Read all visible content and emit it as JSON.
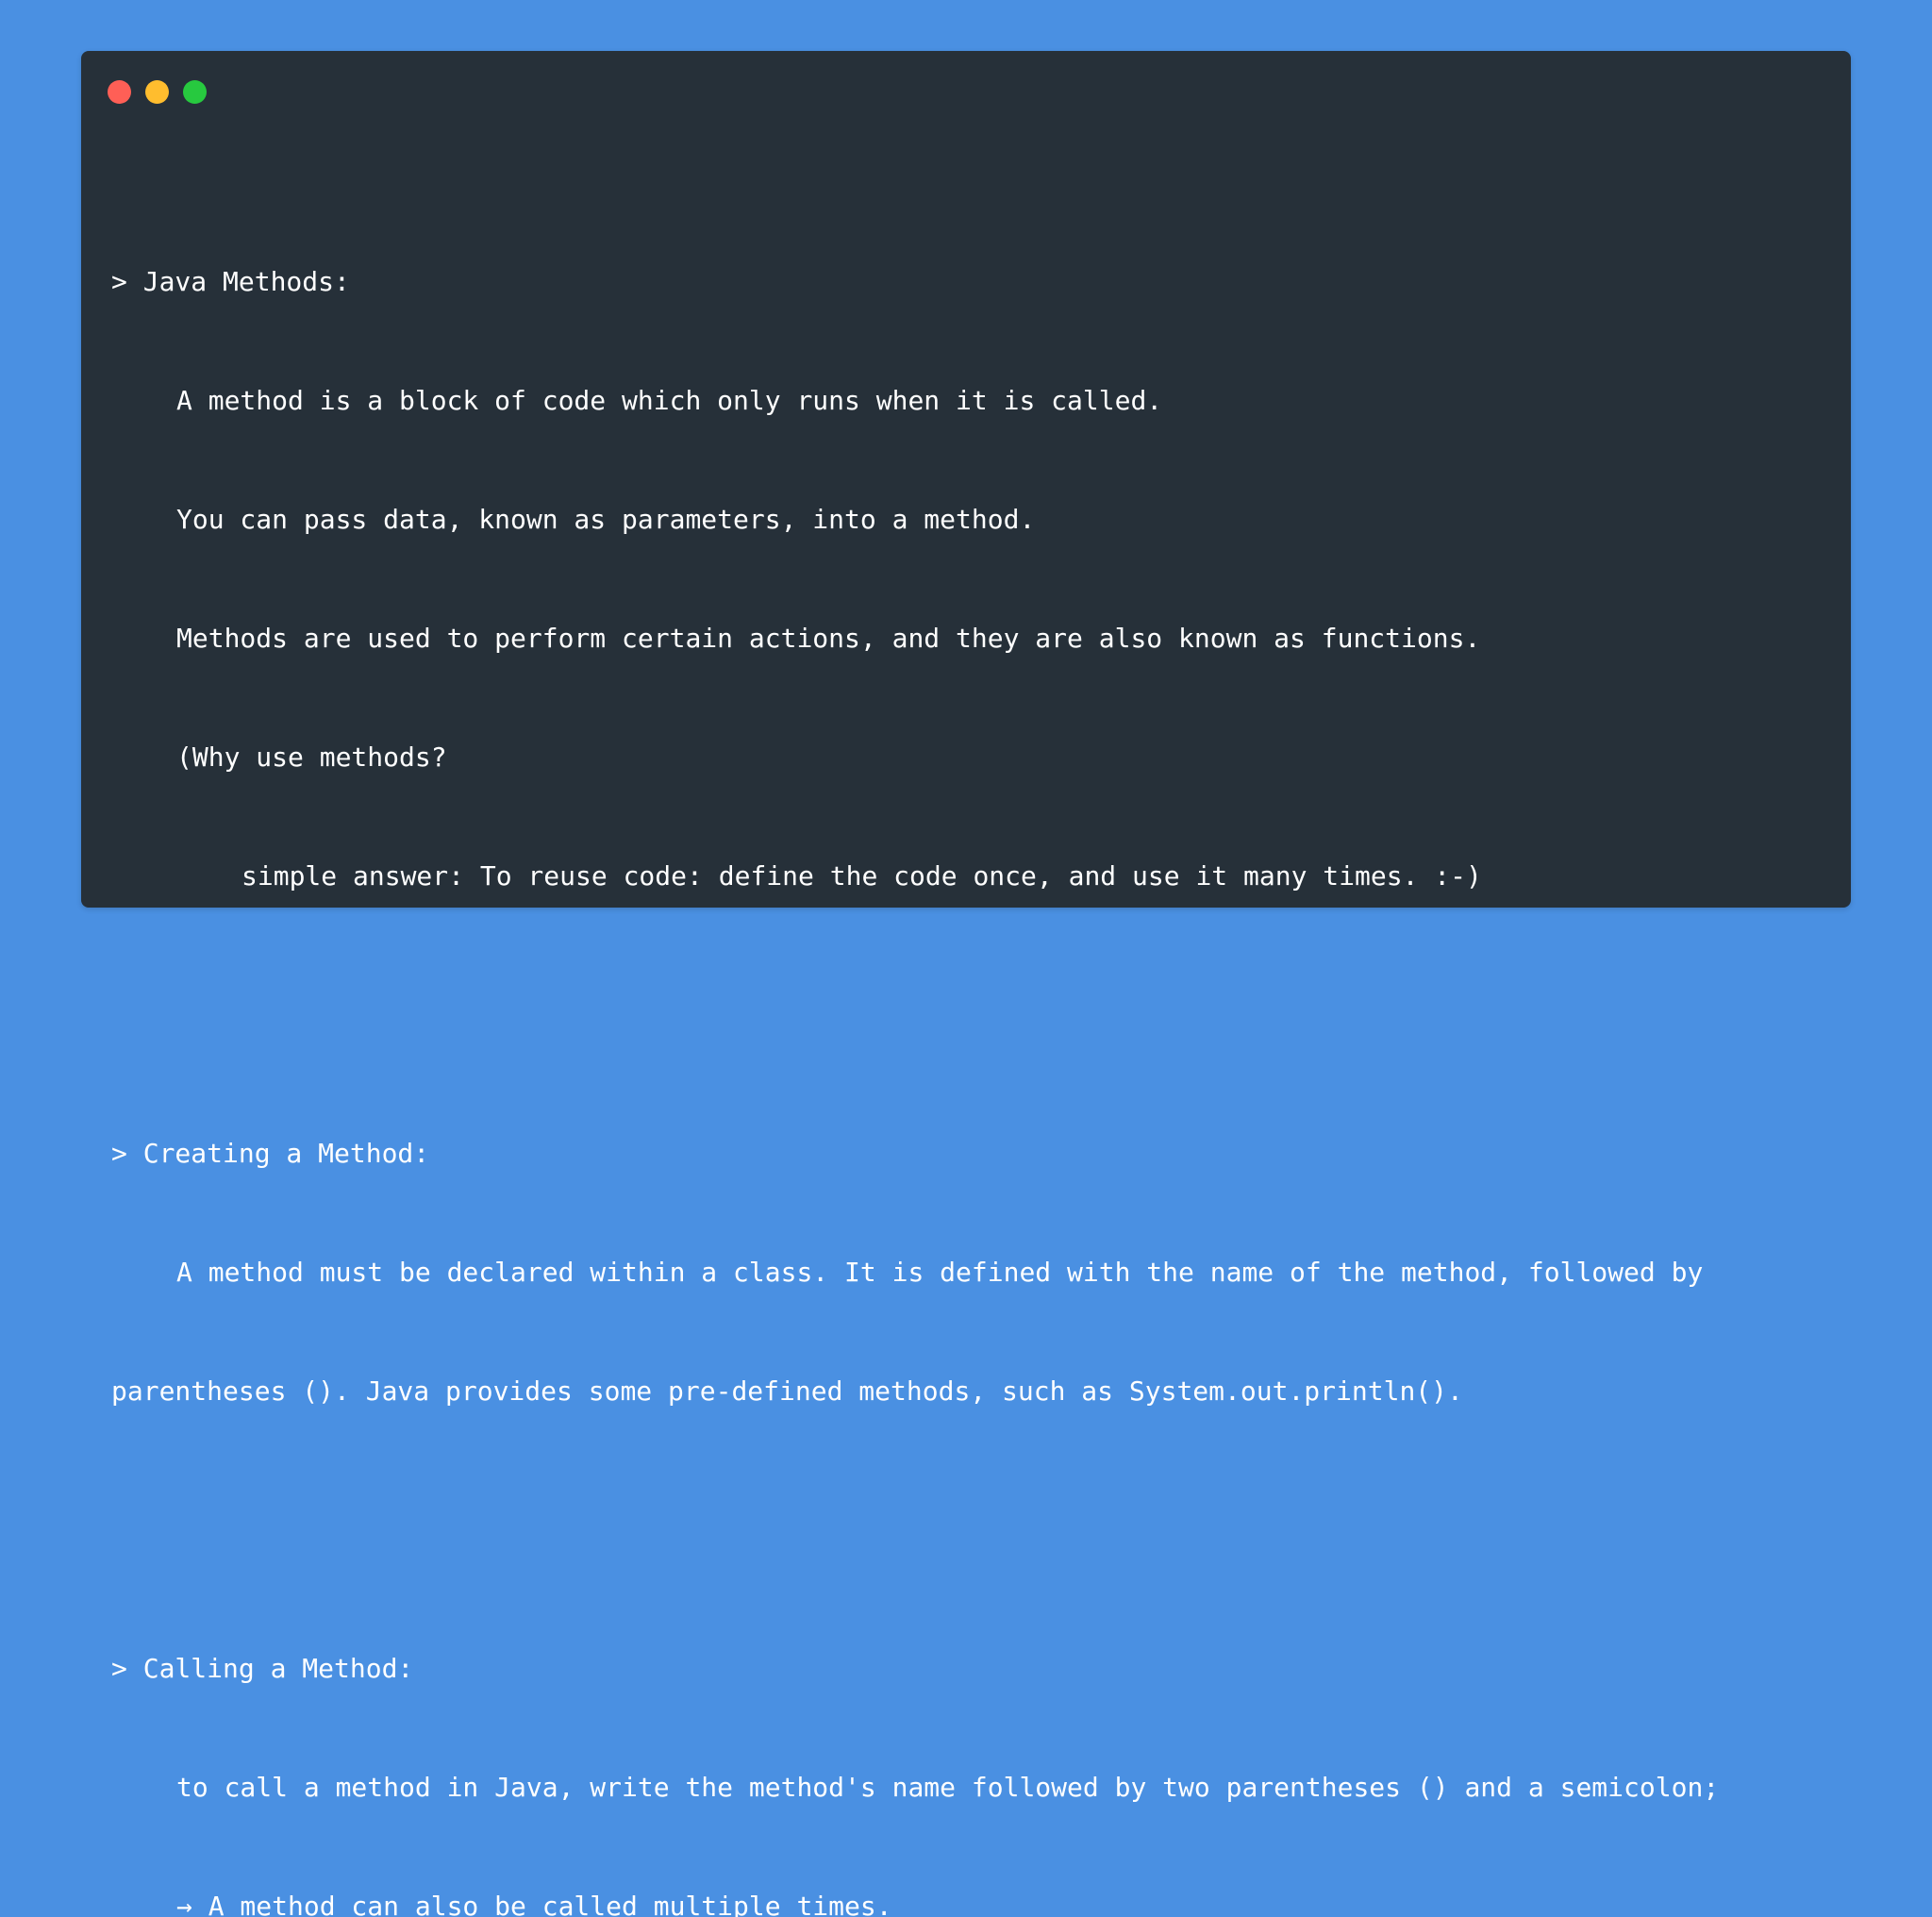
{
  "window": {
    "controls": {
      "close_color": "#ff5f56",
      "minimize_color": "#ffbd2e",
      "maximize_color": "#27c93f"
    }
  },
  "content": {
    "sections": [
      {
        "heading": "> Java Methods:",
        "lines": [
          "A method is a block of code which only runs when it is called.",
          "You can pass data, known as parameters, into a method.",
          "Methods are used to perform certain actions, and they are also known as functions.",
          "(Why use methods?",
          "simple answer: To reuse code: define the code once, and use it many times. :-)"
        ]
      },
      {
        "heading": "> Creating a Method:",
        "lines": [
          "A method must be declared within a class. It is defined with the name of the method, followed by",
          "parentheses (). Java provides some pre-defined methods, such as System.out.println()."
        ]
      },
      {
        "heading": "> Calling a Method:",
        "lines": [
          "to call a method in Java, write the method's name followed by two parentheses () and a semicolon;",
          "→ A method can also be called multiple times."
        ]
      }
    ]
  }
}
